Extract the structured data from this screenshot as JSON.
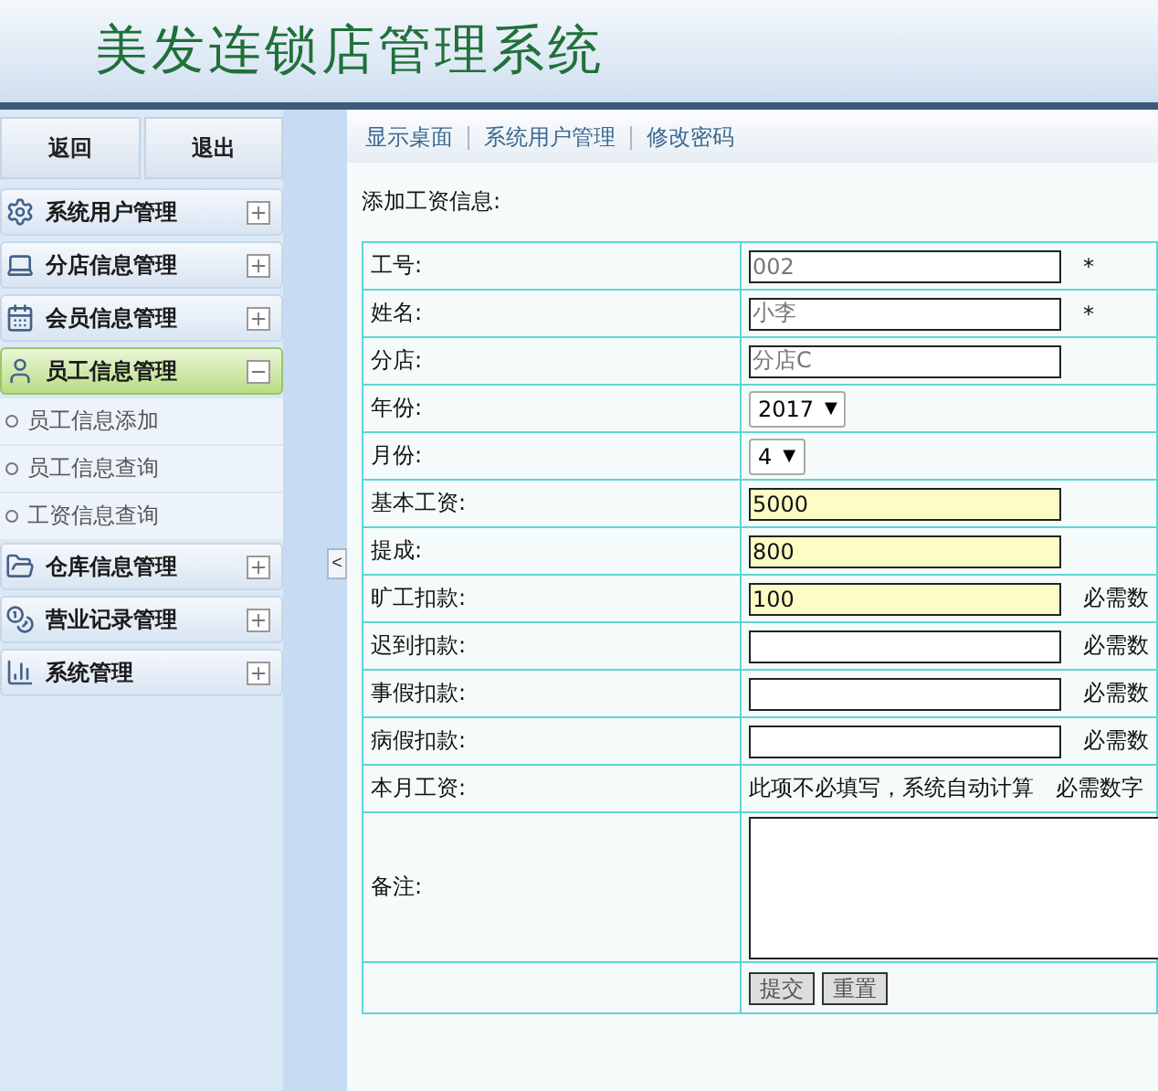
{
  "header": {
    "title": "美发连锁店管理系统"
  },
  "sidebar": {
    "buttons": [
      "返回",
      "退出"
    ],
    "menu": [
      {
        "label": "系统用户管理",
        "expanded": false
      },
      {
        "label": "分店信息管理",
        "expanded": false
      },
      {
        "label": "会员信息管理",
        "expanded": false
      },
      {
        "label": "员工信息管理",
        "expanded": true,
        "children": [
          {
            "label": "员工信息添加"
          },
          {
            "label": "员工信息查询"
          },
          {
            "label": "工资信息查询"
          }
        ]
      },
      {
        "label": "仓库信息管理",
        "expanded": false
      },
      {
        "label": "营业记录管理",
        "expanded": false
      },
      {
        "label": "系统管理",
        "expanded": false
      }
    ]
  },
  "collapse_toggle": "<",
  "breadcrumb": [
    "显示桌面",
    "系统用户管理",
    "修改密码"
  ],
  "form": {
    "title": "添加工资信息:",
    "fields": [
      {
        "label": "工号:",
        "kind": "text",
        "value": "002",
        "readonly": true,
        "highlighted": false,
        "hint": "*"
      },
      {
        "label": "姓名:",
        "kind": "text",
        "value": "小李",
        "readonly": true,
        "highlighted": false,
        "hint": "*"
      },
      {
        "label": "分店:",
        "kind": "text",
        "value": "分店C",
        "readonly": true,
        "highlighted": false
      },
      {
        "label": "年份:",
        "kind": "select",
        "value": "2017",
        "arrow": "▼"
      },
      {
        "label": "月份:",
        "kind": "select",
        "value": "4",
        "arrow": "▼"
      },
      {
        "label": "基本工资:",
        "kind": "text",
        "value": "5000",
        "readonly": false,
        "highlighted": true
      },
      {
        "label": "提成:",
        "kind": "text",
        "value": "800",
        "readonly": false,
        "highlighted": true
      },
      {
        "label": "旷工扣款:",
        "kind": "text",
        "value": "100",
        "readonly": false,
        "highlighted": true,
        "hint": "必需数"
      },
      {
        "label": "迟到扣款:",
        "kind": "text",
        "highlighted": false,
        "hint": "必需数"
      },
      {
        "label": "事假扣款:",
        "kind": "text",
        "highlighted": false,
        "hint": "必需数"
      },
      {
        "label": "病假扣款:",
        "kind": "text",
        "highlighted": false,
        "hint": "必需数"
      },
      {
        "label": "本月工资:",
        "kind": "note",
        "value": "此项不必填写，系统自动计算",
        "hint": "必需数字"
      },
      {
        "label": "备注:",
        "kind": "textarea"
      }
    ],
    "buttons": [
      "提交",
      "重置"
    ]
  }
}
